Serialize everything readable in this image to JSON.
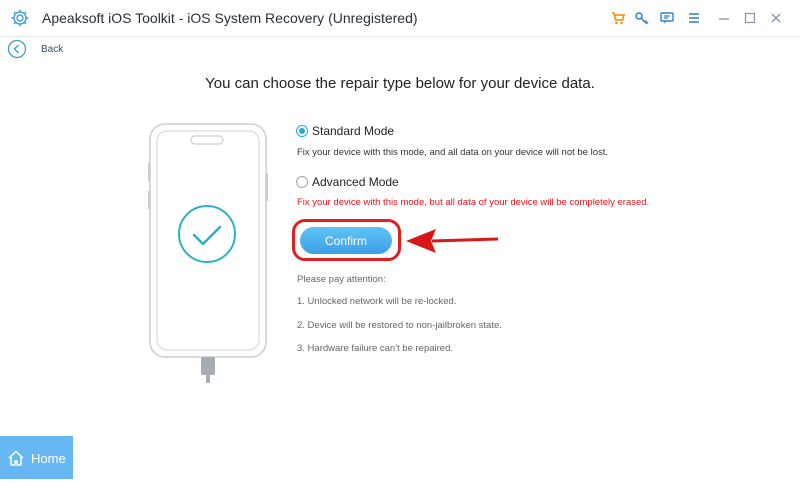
{
  "window": {
    "title": "Apeaksoft iOS Toolkit - iOS System Recovery (Unregistered)",
    "icons": [
      "gear-logo-icon",
      "cart-icon",
      "key-icon",
      "feedback-icon",
      "menu-icon",
      "minimize-icon",
      "maximize-icon",
      "close-icon"
    ]
  },
  "nav": {
    "back_label": "Back"
  },
  "main": {
    "headline": "You can choose the repair type below for your device data.",
    "options": [
      {
        "label": "Standard Mode",
        "selected": true,
        "description": "Fix your device with this mode, and all data on your device will not be lost.",
        "description_color": "#333333"
      },
      {
        "label": "Advanced Mode",
        "selected": false,
        "description": "Fix your device with this mode, but all data of your device will be completely erased.",
        "description_color": "#e0161b"
      }
    ],
    "confirm_label": "Confirm",
    "attention": {
      "title": "Please pay attention:",
      "items": [
        "1. Unlocked network will be re-locked.",
        "2. Device will be restored to non-jailbroken state.",
        "3. Hardware failure can't be repaired."
      ]
    }
  },
  "footer": {
    "home_label": "Home"
  },
  "colors": {
    "accent": "#27a9d6",
    "warning": "#e0161b",
    "highlight": "#e02020",
    "home": "#67b7f2"
  }
}
